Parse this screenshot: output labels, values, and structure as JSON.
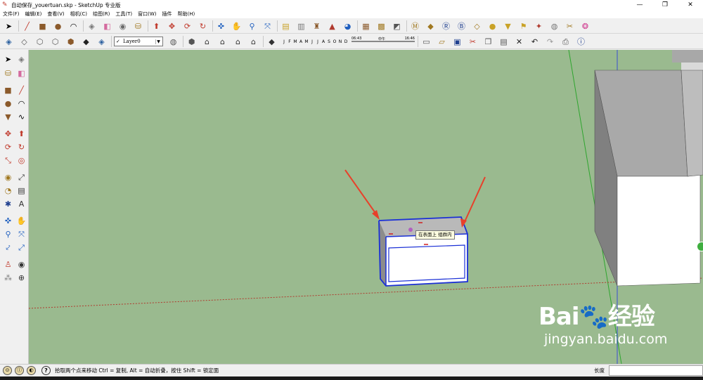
{
  "window": {
    "title": "自动保存_youertuan.skp - SketchUp 专业版",
    "controls": {
      "minimize": "—",
      "maximize": "❐",
      "close": "✕"
    }
  },
  "menu": {
    "items": [
      "文件(F)",
      "编辑(E)",
      "查看(V)",
      "相机(C)",
      "绘图(R)",
      "工具(T)",
      "窗口(W)",
      "插件",
      "帮助(H)"
    ]
  },
  "toolbar": {
    "layer_value": "Layer0",
    "layer_check": "✓",
    "months": [
      "J",
      "F",
      "M",
      "A",
      "M",
      "J",
      "J",
      "A",
      "S",
      "O",
      "N",
      "D"
    ],
    "time_start": "06:43",
    "time_mid": "中午",
    "time_end": "16:46"
  },
  "viewport": {
    "tooltip": "在表面上  组群内"
  },
  "watermark": {
    "logo": "Bai🐾经验",
    "url": "jingyan.baidu.com"
  },
  "status": {
    "help": "?",
    "text": "拾取两个点来移动 Ctrl = 复制, Alt = 自动折叠，按住 Shift = 锁定面",
    "measure_label": "长度",
    "measure_value": ""
  },
  "colors": {
    "sky_ground": "#9aba8f",
    "selection": "#1a2fd6",
    "arrow": "#e8402a"
  }
}
